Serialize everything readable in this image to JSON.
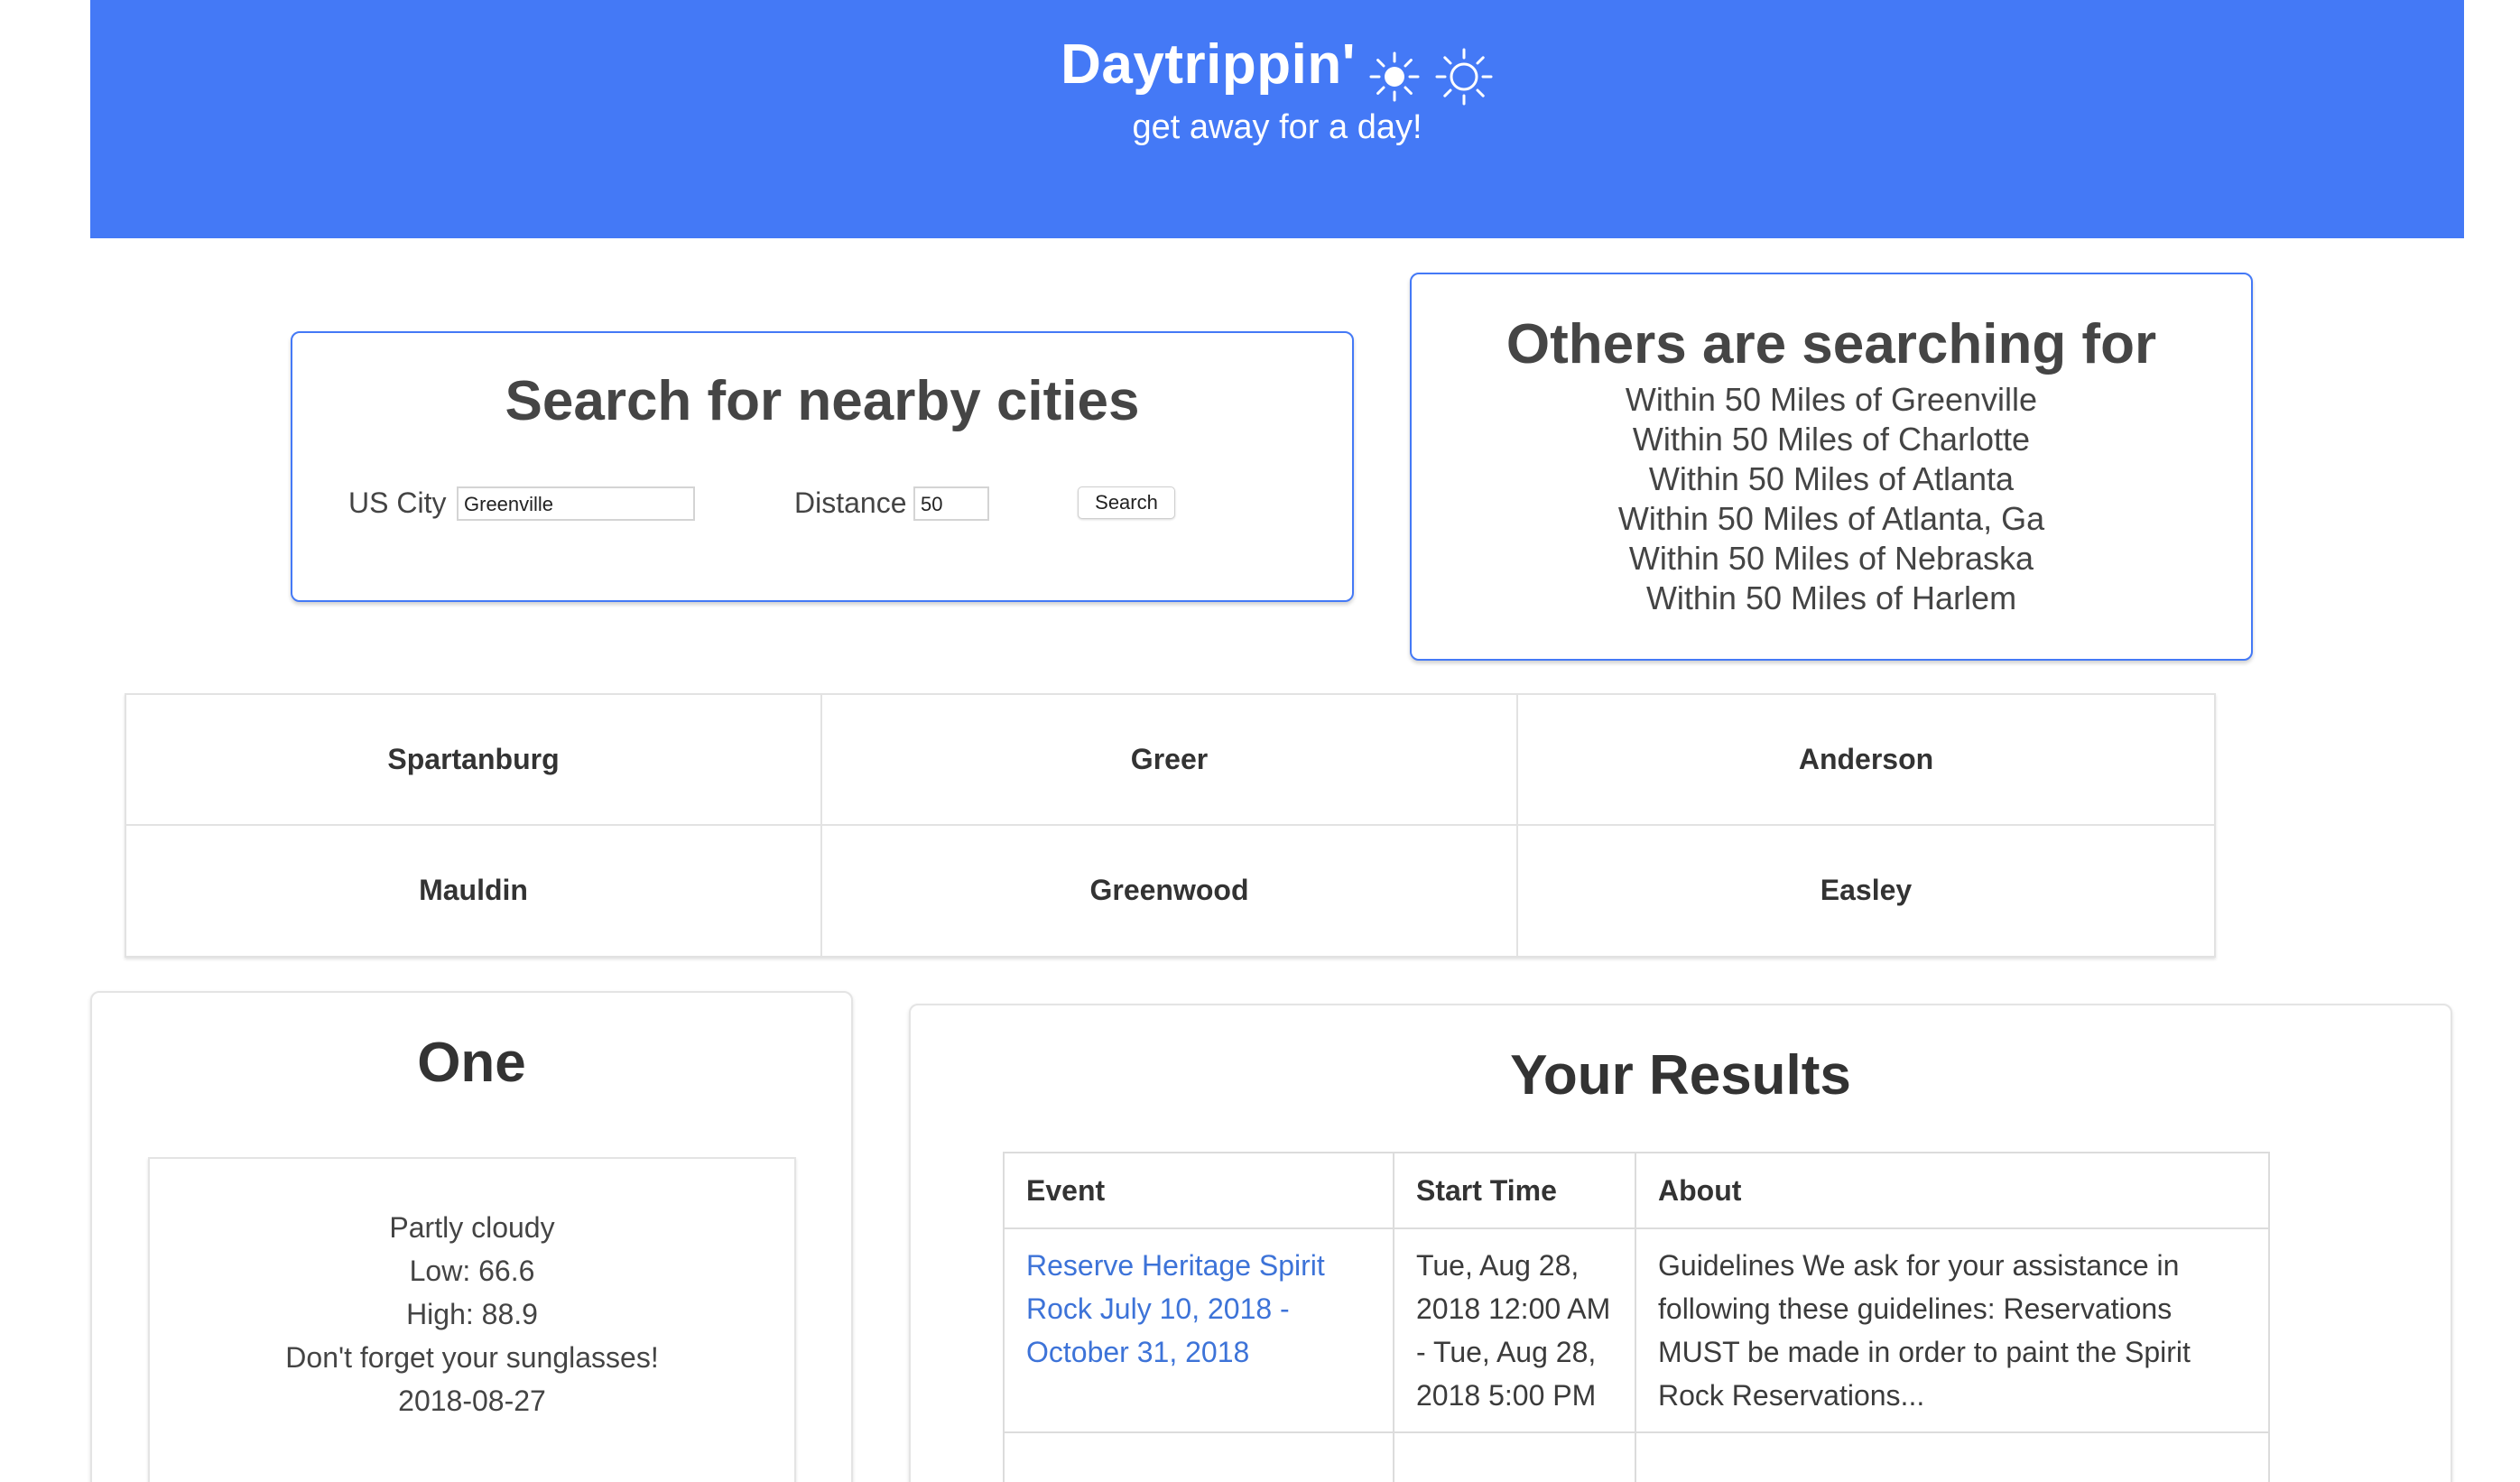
{
  "header": {
    "title": "Daytrippin'",
    "subtitle": "get away for a day!",
    "icons": [
      "sun-filled-icon",
      "sun-outline-icon"
    ],
    "background_color": "#4479f6"
  },
  "search": {
    "heading": "Search for nearby cities",
    "city_label": "US City",
    "city_value": "Greenville",
    "distance_label": "Distance",
    "distance_value": "50",
    "button_label": "Search"
  },
  "others": {
    "heading": "Others are searching for",
    "items": [
      "Within 50 Miles of Greenville",
      "Within 50 Miles of Charlotte",
      "Within 50 Miles of Atlanta",
      "Within 50 Miles of Atlanta, Ga",
      "Within 50 Miles of Nebraska",
      "Within 50 Miles of Harlem"
    ]
  },
  "cities": [
    "Spartanburg",
    "Greer",
    "Anderson",
    "Mauldin",
    "Greenwood",
    "Easley"
  ],
  "weather": {
    "heading": "One",
    "condition": "Partly cloudy",
    "low": "Low: 66.6",
    "high": "High: 88.9",
    "tip": "Don't forget your sunglasses!",
    "date": "2018-08-27"
  },
  "results": {
    "heading": "Your Results",
    "columns": [
      "Event",
      "Start Time",
      "About"
    ],
    "rows": [
      {
        "event": "Reserve Heritage Spirit Rock July 10, 2018 - October 31, 2018",
        "start_time": "Tue, Aug 28, 2018 12:00 AM - Tue, Aug 28, 2018 5:00 PM",
        "about": "Guidelines We ask for your assistance in following these guidelines: Reservations MUST be made in order to paint the Spirit Rock Reservations..."
      }
    ],
    "link_color": "#3d73d8"
  }
}
